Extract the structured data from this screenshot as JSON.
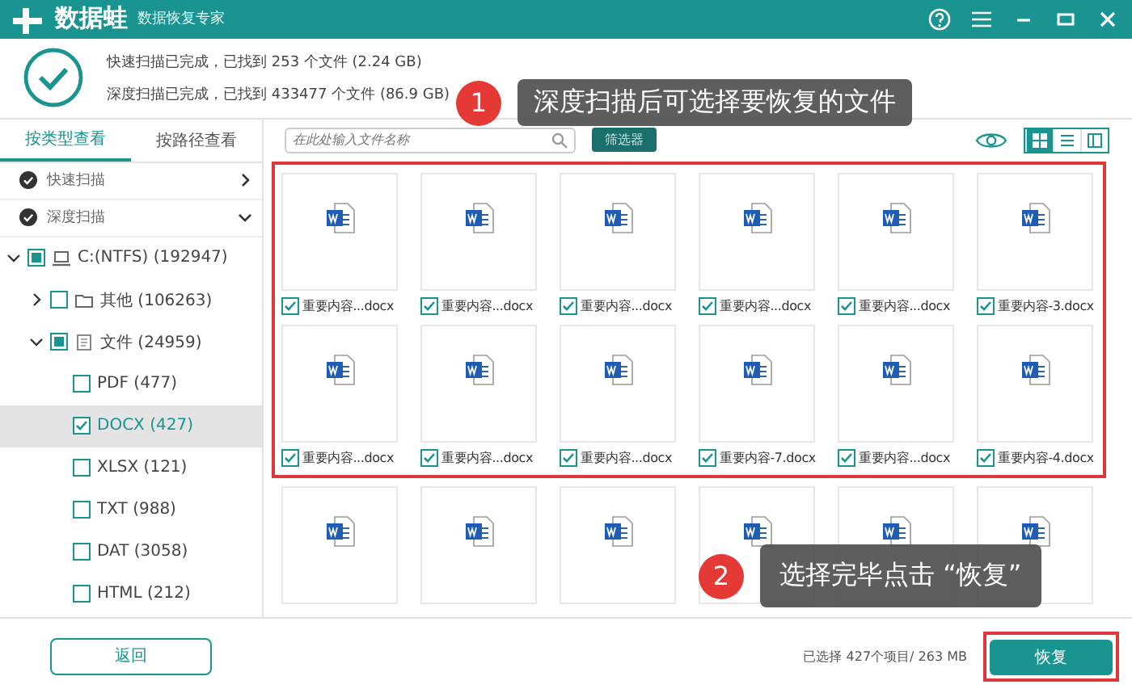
{
  "window": {
    "logo": "数据蛙",
    "subtitle": "数据恢复专家"
  },
  "summary": {
    "lines": [
      "快速扫描已完成，已找到 253 个文件 (2.24 GB)",
      "深度扫描已完成，已找到 433477 个文件 (86.9 GB)"
    ]
  },
  "sidebar": {
    "tabs": [
      {
        "label": "按类型查看",
        "selected": true
      },
      {
        "label": "按路径查看",
        "selected": false
      }
    ],
    "scans": [
      {
        "label": "快速扫描",
        "expanded": false
      },
      {
        "label": "深度扫描",
        "expanded": true
      }
    ],
    "tree": [
      {
        "kind": "drive",
        "label": "C:(NTFS) (192947)",
        "checked": false,
        "partial": true,
        "expanded": true,
        "selected": false,
        "children": [
          {
            "kind": "folder",
            "label": "其他 (106263)",
            "checked": false,
            "partial": false,
            "expanded": false,
            "selected": false
          },
          {
            "kind": "files",
            "label": "文件 (24959)",
            "checked": false,
            "partial": true,
            "expanded": true,
            "selected": false,
            "children": [
              {
                "label": "PDF (477)",
                "checked": false,
                "selected": false
              },
              {
                "label": "DOCX (427)",
                "checked": true,
                "selected": true
              },
              {
                "label": "XLSX (121)",
                "checked": false,
                "selected": false
              },
              {
                "label": "TXT (988)",
                "checked": false,
                "selected": false
              },
              {
                "label": "DAT (3058)",
                "checked": false,
                "selected": false
              },
              {
                "label": "HTML (212)",
                "checked": false,
                "selected": false
              }
            ]
          }
        ]
      }
    ]
  },
  "toolbar": {
    "search": {
      "placeholder": "在此处输入文件名称"
    },
    "filter_button": "筛选器",
    "views": [
      {
        "kind": "grid",
        "selected": true
      },
      {
        "kind": "list",
        "selected": false
      },
      {
        "kind": "columns",
        "selected": false
      }
    ]
  },
  "files": [
    {
      "name": "重要内容...docx",
      "checked": true
    },
    {
      "name": "重要内容...docx",
      "checked": true
    },
    {
      "name": "重要内容...docx",
      "checked": true
    },
    {
      "name": "重要内容...docx",
      "checked": true
    },
    {
      "name": "重要内容...docx",
      "checked": true
    },
    {
      "name": "重要内容-3.docx",
      "checked": true
    },
    {
      "name": "重要内容...docx",
      "checked": true
    },
    {
      "name": "重要内容...docx",
      "checked": true
    },
    {
      "name": "重要内容...docx",
      "checked": true
    },
    {
      "name": "重要内容-7.docx",
      "checked": true
    },
    {
      "name": "重要内容...docx",
      "checked": true
    },
    {
      "name": "重要内容-4.docx",
      "checked": true
    }
  ],
  "more_files": [
    {
      "kind": "docx"
    },
    {
      "kind": "docx"
    },
    {
      "kind": "docx"
    },
    {
      "kind": "docx"
    },
    {
      "kind": "docx"
    },
    {
      "kind": "docx"
    }
  ],
  "footer": {
    "back_button": "返回",
    "status": "已选择 427个项目/ 263 MB",
    "recover_button": "恢复"
  },
  "callouts": [
    {
      "number": "1",
      "text": "深度扫描后可选择要恢复的文件"
    },
    {
      "number": "2",
      "text": "选择完毕点击 “恢复”"
    }
  ]
}
